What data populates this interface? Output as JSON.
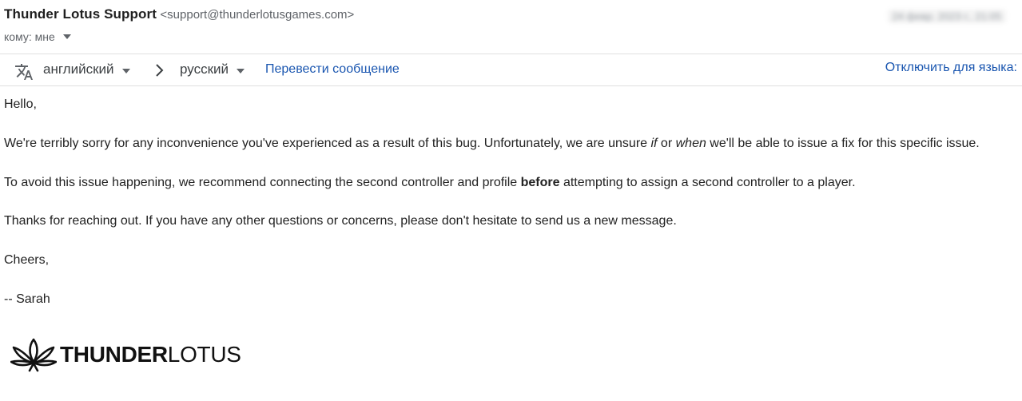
{
  "header": {
    "sender_name": "Thunder Lotus Support",
    "sender_email": "<support@thunderlotusgames.com>",
    "recipient_label": "кому: мне",
    "date_blurred": "24 февр. 2023 г., 21:05"
  },
  "translate_bar": {
    "translate_icon": "translate-icon",
    "source_language": "английский",
    "target_language": "русский",
    "translate_message_label": "Перевести сообщение",
    "disable_for_language_label": "Отключить для языка:"
  },
  "body": {
    "greeting": "Hello,",
    "p1": {
      "part1": "We're terribly sorry for any inconvenience you've experienced as a result of this bug. Unfortunately, we are unsure ",
      "em1": "if",
      "part2": " or ",
      "em2": "when",
      "part3": " we'll be able to issue a fix for this specific issue."
    },
    "p2": {
      "part1": "To avoid this issue happening, we recommend connecting the second controller and profile ",
      "strong": "before",
      "part2": " attempting to assign a second controller to a player."
    },
    "p3": "Thanks for reaching out. If you have any other questions or concerns, please don't hesitate to send us a new message.",
    "closing": "Cheers,",
    "signature": "-- Sarah"
  },
  "signature_logo": {
    "icon": "lotus-logo-icon",
    "word_bold": "THUNDER",
    "word_light": "LOTUS"
  },
  "colors": {
    "link": "#1a56b0",
    "text": "#222222",
    "muted": "#5f6368",
    "divider": "#e0e0e0"
  }
}
